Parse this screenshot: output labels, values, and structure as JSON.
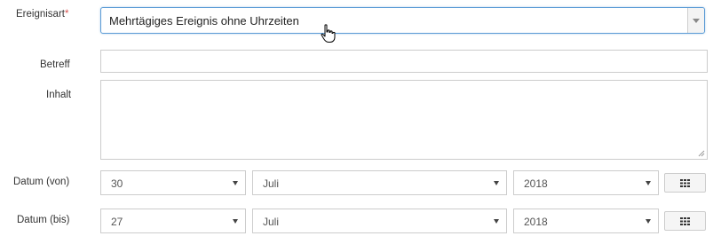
{
  "form": {
    "event_type": {
      "label": "Ereignisart",
      "required_mark": "*",
      "value": "Mehrtägiges Ereignis ohne Uhrzeiten"
    },
    "subject": {
      "label": "Betreff",
      "value": ""
    },
    "content": {
      "label": "Inhalt",
      "value": ""
    },
    "date_from": {
      "label": "Datum (von)",
      "day": "30",
      "month": "Juli",
      "year": "2018"
    },
    "date_to": {
      "label": "Datum (bis)",
      "day": "27",
      "month": "Juli",
      "year": "2018"
    }
  },
  "icons": {
    "calendar_button": "calendar-grid-icon",
    "select_arrow": "chevron-down-icon",
    "cursor": "hand-pointer-cursor"
  },
  "colors": {
    "focus_border": "#5b9bd5",
    "required": "#d9534f",
    "border": "#cccccc"
  }
}
